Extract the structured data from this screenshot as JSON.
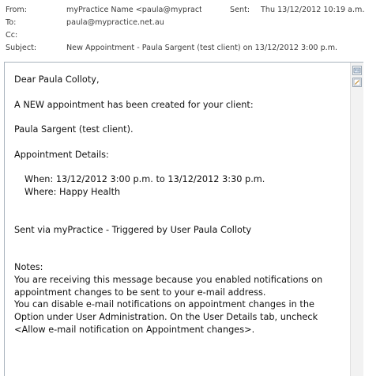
{
  "header": {
    "from_label": "From:",
    "from_value": "myPractice Name <paula@mypractice.net.au>",
    "sent_label": "Sent:",
    "sent_value": "Thu 13/12/2012 10:19 a.m.",
    "to_label": "To:",
    "to_value": "paula@mypractice.net.au",
    "cc_label": "Cc:",
    "cc_value": "",
    "subject_label": "Subject:",
    "subject_value": "New Appointment - Paula Sargent (test client) on 13/12/2012 3:00 p.m."
  },
  "body": {
    "greeting": "Dear Paula Colloty,",
    "intro": "A NEW appointment has been created for your client:",
    "client": "Paula Sargent (test client).",
    "details_heading": "Appointment Details:",
    "when": "When: 13/12/2012 3:00 p.m. to 13/12/2012 3:30 p.m.",
    "where": "Where: Happy Health",
    "sent_via": "Sent via myPractice - Triggered by User Paula Colloty",
    "notes_heading": "Notes:",
    "notes_line1": "You are receiving this message because you enabled notifications on",
    "notes_line2": "appointment changes to be sent to your e-mail address.",
    "notes_line3": "You can disable e-mail notifications on appointment changes in the",
    "notes_line4": "Option under User Administration. On the User Details tab, uncheck",
    "notes_line5": "<Allow e-mail notification on Appointment changes>."
  },
  "icons": {
    "scroll_top": "contact-card-icon",
    "scroll_second": "edit-icon"
  }
}
